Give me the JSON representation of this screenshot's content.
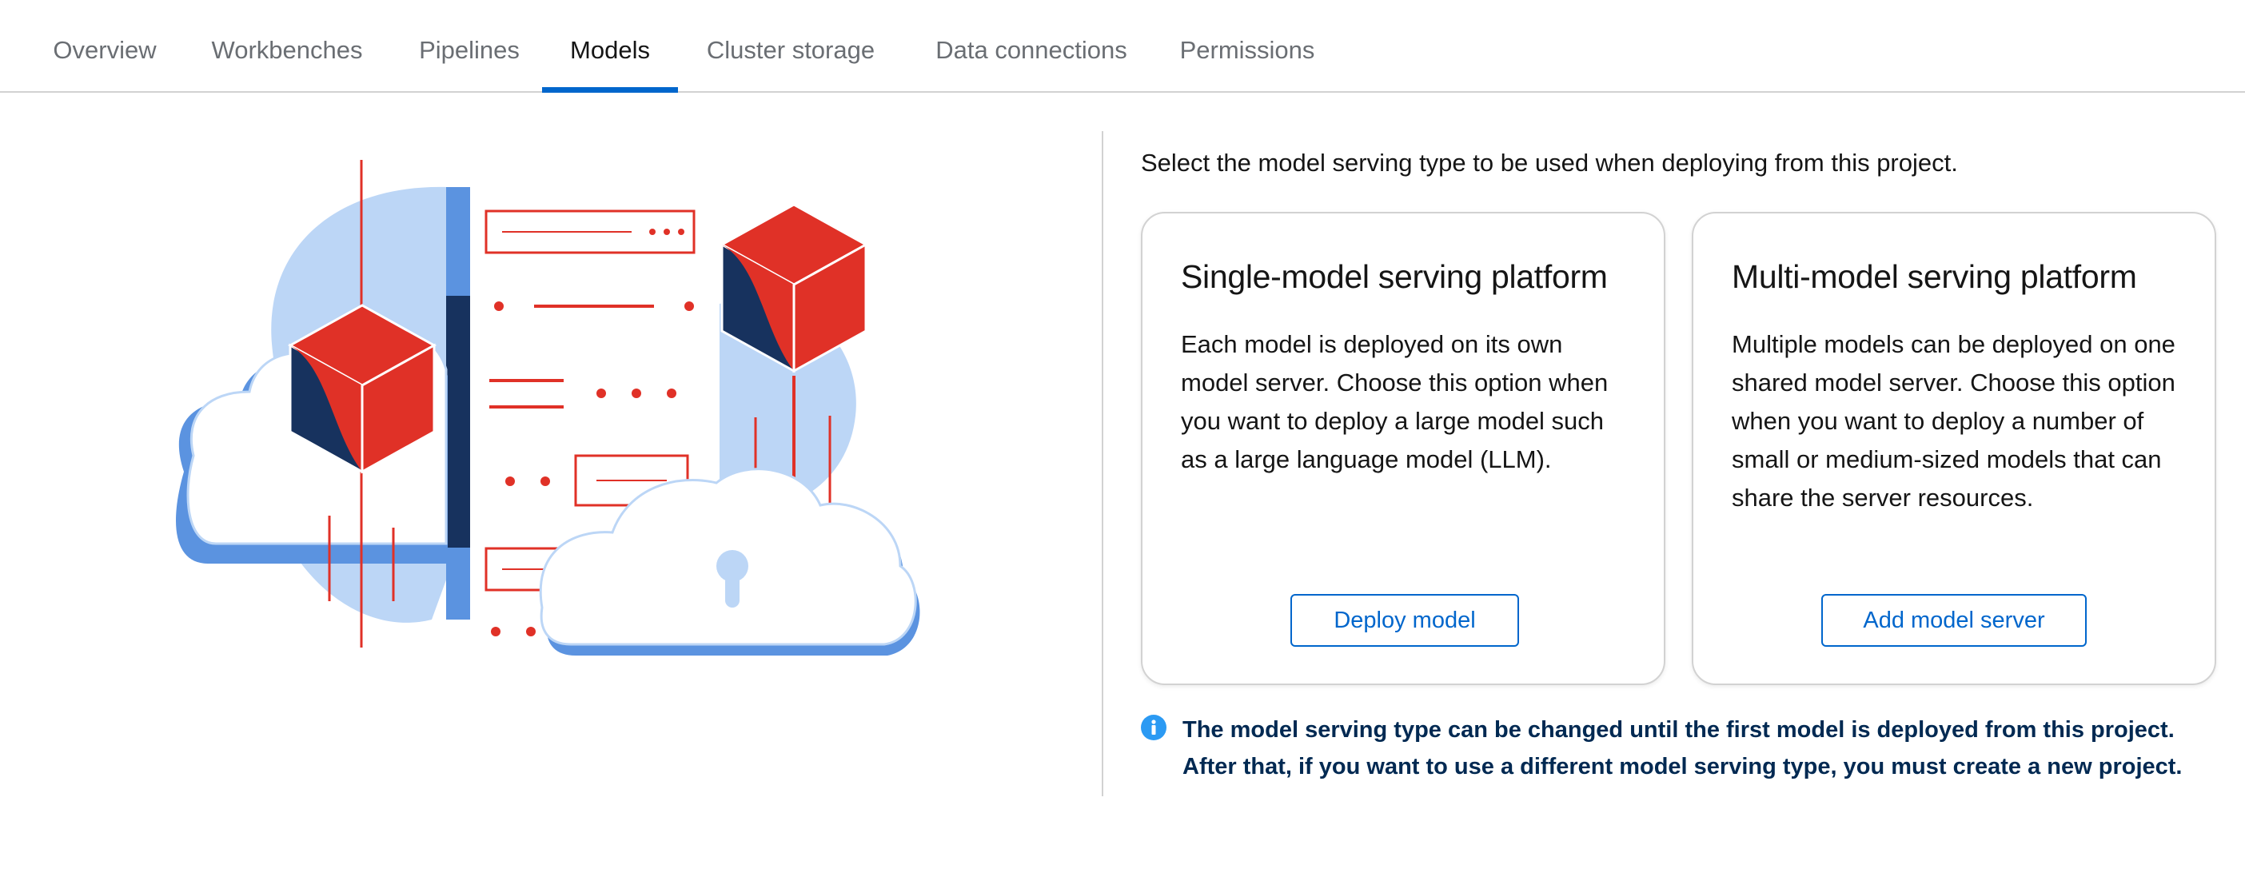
{
  "tabs": [
    {
      "label": "Overview",
      "active": false
    },
    {
      "label": "Workbenches",
      "active": false
    },
    {
      "label": "Pipelines",
      "active": false
    },
    {
      "label": "Models",
      "active": true
    },
    {
      "label": "Cluster storage",
      "active": false
    },
    {
      "label": "Data connections",
      "active": false
    },
    {
      "label": "Permissions",
      "active": false
    }
  ],
  "main": {
    "intro": "Select the model serving type to be used when deploying from this project.",
    "cards": [
      {
        "title": "Single-model serving platform",
        "body": "Each model is deployed on its own model server. Choose this option when you want to deploy a large model such as a large language model (LLM).",
        "button": "Deploy model"
      },
      {
        "title": "Multi-model serving platform",
        "body": "Multiple models can be deployed on one shared model server. Choose this option when you want to deploy a number of small or medium-sized models that can share the server resources.",
        "button": "Add model server"
      }
    ],
    "alert": {
      "icon": "info-icon",
      "text": "The model serving type can be changed until the first model is deployed from this project. After that, if you want to use a different model serving type, you must create a new project."
    }
  },
  "colors": {
    "accent": "#0066cc",
    "illustration_red": "#e03127",
    "illustration_navy": "#17325e",
    "illustration_blue": "#5b93e0",
    "illustration_light_blue": "#bcd6f6",
    "alert_text": "#002952"
  }
}
